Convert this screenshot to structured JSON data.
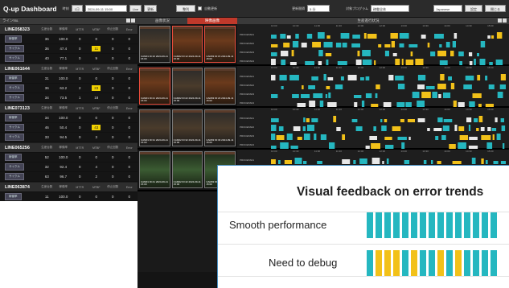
{
  "topbar": {
    "title": "Q-up Dashboard",
    "date_label": "時刻",
    "range_btn": "1日",
    "datetime": "2024-09-11 15:00",
    "select_suffix": "▽",
    "now_btn": "Live",
    "update_btn": "更新",
    "view_btn": "整列",
    "auto_label": "自動更新",
    "interval_label": "更新間隔",
    "interval_value": "5 分",
    "program_label": "対象プログラム",
    "program_value": "稼働全体",
    "lang_value": "Japanese",
    "settings_btn": "設定",
    "close_btn": "閉じる"
  },
  "left": {
    "header": "ラインNo.",
    "col_headers": [
      "生産台数",
      "稼働率",
      "MTTR",
      "MTBF",
      "停止回数",
      "Error"
    ],
    "lines": [
      {
        "name": "LINE058323",
        "rows": [
          {
            "label": "稼働率",
            "cells": [
              "36",
              "100.0",
              "0",
              "0",
              "0",
              "0"
            ],
            "hl": -1
          },
          {
            "label": "サイクル",
            "cells": [
              "36",
              "47.4",
              "0",
              "11",
              "0",
              "0"
            ],
            "hl": 3
          },
          {
            "label": "サイクル",
            "cells": [
              "40",
              "77.1",
              "0",
              "9",
              "0",
              "0"
            ],
            "hl": -1
          }
        ]
      },
      {
        "name": "LINE061644",
        "rows": [
          {
            "label": "稼働率",
            "cells": [
              "31",
              "100.0",
              "0",
              "0",
              "0",
              "0"
            ],
            "hl": -1
          },
          {
            "label": "サイクル",
            "cells": [
              "36",
              "63.2",
              "2",
              "23",
              "0",
              "0"
            ],
            "hl": 3
          },
          {
            "label": "サイクル",
            "cells": [
              "34",
              "73.5",
              "1",
              "18",
              "0",
              "0"
            ],
            "hl": -1
          }
        ]
      },
      {
        "name": "LINE073123",
        "rows": [
          {
            "label": "稼働率",
            "cells": [
              "34",
              "100.0",
              "0",
              "0",
              "0",
              "0"
            ],
            "hl": -1
          },
          {
            "label": "サイクル",
            "cells": [
              "46",
              "50.4",
              "0",
              "43",
              "0",
              "0"
            ],
            "hl": 3
          },
          {
            "label": "サイクル",
            "cells": [
              "33",
              "94.5",
              "0",
              "3",
              "0",
              "0"
            ],
            "hl": -1
          }
        ]
      },
      {
        "name": "LINE065256",
        "rows": [
          {
            "label": "稼働率",
            "cells": [
              "52",
              "100.0",
              "0",
              "0",
              "0",
              "0"
            ],
            "hl": -1
          },
          {
            "label": "サイクル",
            "cells": [
              "32",
              "92.4",
              "0",
              "4",
              "0",
              "0"
            ],
            "hl": -1
          },
          {
            "label": "サイクル",
            "cells": [
              "63",
              "96.7",
              "0",
              "2",
              "0",
              "0"
            ],
            "hl": -1
          }
        ]
      },
      {
        "name": "LINE063874",
        "rows": [
          {
            "label": "稼働率",
            "cells": [
              "11",
              "100.0",
              "0",
              "0",
              "0",
              "0"
            ],
            "hl": -1
          },
          {
            "label": "サイクル",
            "cells": [
              "33",
              "100.0",
              "0",
              "0",
              "0",
              "0"
            ],
            "hl": -1
          },
          {
            "label": "サイクル",
            "cells": [
              "6",
              "100.0",
              "0",
              "0",
              "0",
              "0"
            ],
            "hl": -1
          }
        ]
      }
    ]
  },
  "middle": {
    "tabs": [
      "画像状況",
      "映像画像"
    ],
    "blocks": [
      {
        "thumbs": [
          {
            "style": "alt",
            "red": false,
            "text": "CAM01 ID:10 2024-09-11 15:00"
          },
          {
            "style": "",
            "red": true,
            "text": "CAM02 ID:12 2024-09-11 15:00"
          },
          {
            "style": "",
            "red": true,
            "text": "CAM03 ID:15 2024-09-11 15:00"
          }
        ]
      },
      {
        "thumbs": [
          {
            "style": "",
            "red": true,
            "text": "CAM01 ID:21 2024-09-11 15:00"
          },
          {
            "style": "alt",
            "red": false,
            "text": "CAM02 ID:22 2024-09-11 15:00"
          },
          {
            "style": "",
            "red": false,
            "text": "CAM03 ID:23 2024-09-11 15:00"
          }
        ]
      },
      {
        "thumbs": [
          {
            "style": "alt",
            "red": false,
            "text": "CAM01 ID:31 2024-09-11 15:00"
          },
          {
            "style": "alt",
            "red": false,
            "text": "CAM02 ID:32 2024-09-11 15:00"
          },
          {
            "style": "alt",
            "red": false,
            "text": "CAM03 ID:33 2024-09-11 15:00"
          }
        ]
      },
      {
        "thumbs": [
          {
            "style": "green",
            "red": false,
            "text": "CAM01 ID:41 2024-09-11 15:00"
          },
          {
            "style": "green",
            "red": false,
            "text": "CAM02 ID:42 2024-09-11 15:00"
          },
          {
            "style": "green",
            "red": false,
            "text": "CAM03 ID:43 2024-09-11 15:00"
          }
        ]
      }
    ]
  },
  "right": {
    "header": "生産進行状況",
    "axis": [
      "10:00",
      "10:30",
      "11:00",
      "11:30",
      "12:00",
      "12:30",
      "13:00",
      "13:30",
      "14:00",
      "14:30",
      "15:00"
    ],
    "row_labels": [
      "PROCESS01",
      "PROCESS02",
      "PROCESS03",
      "PROCESS04"
    ]
  },
  "overlay": {
    "title": "Visual feedback on error trends",
    "smooth_label": "Smooth performance",
    "debug_label": "Need to debug",
    "colors": {
      "teal": "#25b7c0",
      "yellow": "#f2c119",
      "accent_line": "#4a90c2"
    },
    "smooth_pattern": [
      "teal",
      "teal",
      "teal",
      "teal",
      "teal",
      "teal",
      "teal",
      "teal",
      "teal",
      "teal",
      "teal",
      "teal",
      "teal",
      "teal",
      "teal"
    ],
    "debug_pattern": [
      "teal",
      "yellow",
      "yellow",
      "yellow",
      "teal",
      "yellow",
      "teal",
      "teal",
      "yellow",
      "teal",
      "yellow",
      "teal",
      "teal",
      "teal",
      "teal"
    ]
  }
}
